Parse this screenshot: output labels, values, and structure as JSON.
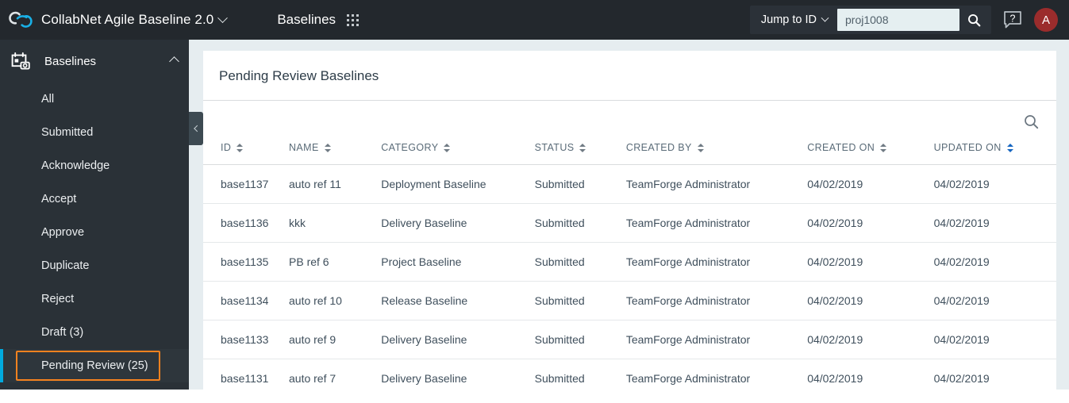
{
  "header": {
    "logo_icon": "collabnet-rings-logo",
    "app_title": "CollabNet Agile Baseline 2.0",
    "section_title": "Baselines",
    "apps_grid_icon": "apps-grid-icon",
    "jump_to_id_label": "Jump to ID",
    "search_value": "proj1008",
    "search_placeholder": "",
    "search_icon": "search-icon",
    "help_icon": "help-question-icon",
    "avatar_initial": "A",
    "avatar_color": "#9b2c2c",
    "bar_color": "#23282d"
  },
  "sidebar": {
    "group_icon": "calendar-camera-icon",
    "group_label": "Baselines",
    "collapse_icon": "chevron-up-icon",
    "accent_color": "#00aadf",
    "focus_color": "#f5821f",
    "collapse_handle_icon": "chevron-left-icon",
    "items": [
      {
        "label": "All",
        "active": false
      },
      {
        "label": "Submitted",
        "active": false
      },
      {
        "label": "Acknowledge",
        "active": false
      },
      {
        "label": "Accept",
        "active": false
      },
      {
        "label": "Approve",
        "active": false
      },
      {
        "label": "Duplicate",
        "active": false
      },
      {
        "label": "Reject",
        "active": false
      },
      {
        "label": "Draft (3)",
        "active": false
      },
      {
        "label": "Pending Review (25)",
        "active": true
      }
    ]
  },
  "main": {
    "card_title": "Pending Review Baselines",
    "table_search_icon": "search-icon",
    "columns": [
      {
        "label": "ID",
        "sorted": false
      },
      {
        "label": "NAME",
        "sorted": false
      },
      {
        "label": "CATEGORY",
        "sorted": false
      },
      {
        "label": "STATUS",
        "sorted": false
      },
      {
        "label": "CREATED BY",
        "sorted": false
      },
      {
        "label": "CREATED ON",
        "sorted": false
      },
      {
        "label": "UPDATED ON",
        "sorted": true
      }
    ],
    "rows": [
      {
        "id": "base1137",
        "name": "auto ref 11",
        "category": "Deployment Baseline",
        "status": "Submitted",
        "created_by": "TeamForge Administrator",
        "created_on": "04/02/2019",
        "updated_on": "04/02/2019"
      },
      {
        "id": "base1136",
        "name": "kkk",
        "category": "Delivery Baseline",
        "status": "Submitted",
        "created_by": "TeamForge Administrator",
        "created_on": "04/02/2019",
        "updated_on": "04/02/2019"
      },
      {
        "id": "base1135",
        "name": "PB ref 6",
        "category": "Project Baseline",
        "status": "Submitted",
        "created_by": "TeamForge Administrator",
        "created_on": "04/02/2019",
        "updated_on": "04/02/2019"
      },
      {
        "id": "base1134",
        "name": "auto ref 10",
        "category": "Release Baseline",
        "status": "Submitted",
        "created_by": "TeamForge Administrator",
        "created_on": "04/02/2019",
        "updated_on": "04/02/2019"
      },
      {
        "id": "base1133",
        "name": "auto ref 9",
        "category": "Delivery Baseline",
        "status": "Submitted",
        "created_by": "TeamForge Administrator",
        "created_on": "04/02/2019",
        "updated_on": "04/02/2019"
      },
      {
        "id": "base1131",
        "name": "auto ref 7",
        "category": "Delivery Baseline",
        "status": "Submitted",
        "created_by": "TeamForge Administrator",
        "created_on": "04/02/2019",
        "updated_on": "04/02/2019"
      }
    ]
  }
}
